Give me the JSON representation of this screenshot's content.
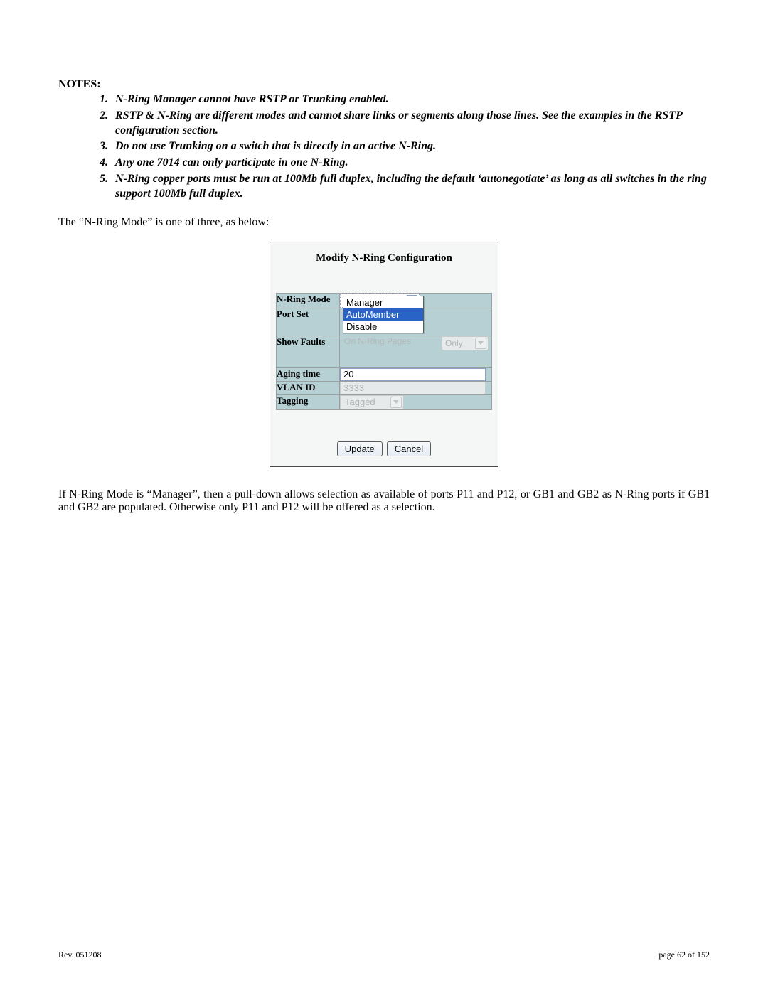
{
  "notes_heading": "NOTES:",
  "notes": [
    "N-Ring Manager cannot have RSTP or Trunking enabled.",
    "RSTP & N-Ring are different modes and cannot share links or segments along those lines. See the examples in the RSTP configuration section.",
    "Do not use Trunking on a switch that is directly in an active N-Ring.",
    "Any one 7014 can only participate in one N-Ring.",
    "N-Ring copper ports must be run at 100Mb full duplex, including the default ‘autonegotiate’ as long as all switches in the ring support 100Mb full duplex."
  ],
  "intro": "The “N-Ring Mode” is one of three, as below:",
  "config": {
    "title": "Modify N-Ring Configuration",
    "labels": {
      "mode": "N-Ring Mode",
      "portset": "Port Set",
      "showfaults": "Show Faults",
      "agingtime": "Aging time",
      "vlanid": "VLAN ID",
      "tagging": "Tagging"
    },
    "mode": {
      "selected": "AutoMember",
      "options": [
        "Manager",
        "AutoMember",
        "Disable"
      ],
      "highlight_index": 1
    },
    "showfaults": {
      "bg_hint_left": "On N-Ring Pages",
      "bg_hint_right": "Only"
    },
    "agingtime_value": "20",
    "vlanid_value": "3333",
    "tagging_value": "Tagged",
    "buttons": {
      "update": "Update",
      "cancel": "Cancel"
    }
  },
  "after_para": "If N-Ring Mode is “Manager”, then a pull-down allows selection as available of ports P11 and P12, or GB1 and GB2 as N-Ring ports if GB1 and GB2 are populated. Otherwise only P11 and P12 will be offered as a selection.",
  "footer": {
    "left": "Rev.  051208",
    "right": "page 62 of 152"
  }
}
